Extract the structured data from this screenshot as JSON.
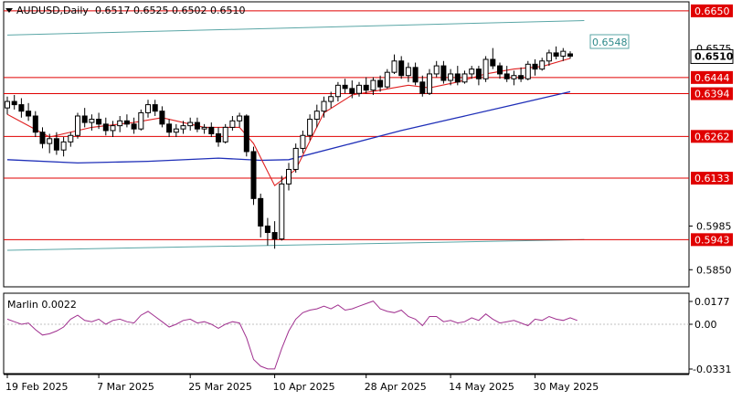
{
  "header": {
    "symbol_timeframe": "AUDUSD,Daily",
    "ohlc": "0.6517 0.6525 0.6502 0.6510"
  },
  "indicator": {
    "label": "Marlin 0.0022",
    "levels": [
      "0.0177",
      "0.00",
      "-0.0331"
    ]
  },
  "price_labels": {
    "current": "0.6510",
    "channel": "0.6548",
    "partial": "0.6575",
    "plain": [
      "0.5985",
      "0.5850"
    ]
  },
  "levels": [
    {
      "price": 0.665,
      "label": "0.6650"
    },
    {
      "price": 0.6444,
      "label": "0.6444"
    },
    {
      "price": 0.6394,
      "label": "0.6394"
    },
    {
      "price": 0.6262,
      "label": "0.6262"
    },
    {
      "price": 0.6133,
      "label": "0.6133"
    },
    {
      "price": 0.5943,
      "label": "0.5943"
    }
  ],
  "x_ticks": [
    {
      "i": 0,
      "label": "19 Feb 2025"
    },
    {
      "i": 13,
      "label": "7 Mar 2025"
    },
    {
      "i": 26,
      "label": "25 Mar 2025"
    },
    {
      "i": 38,
      "label": "10 Apr 2025"
    },
    {
      "i": 51,
      "label": "28 Apr 2025"
    },
    {
      "i": 63,
      "label": "14 May 2025"
    },
    {
      "i": 75,
      "label": "30 May 2025"
    }
  ],
  "colors": {
    "level_lines": "#e00000",
    "level_label_bg": "#e00000",
    "ma_fast": "#e02020",
    "ma_slow": "#1f2fb8",
    "channel": "#5aa6a6",
    "oscillator": "#a0308f",
    "candle_bull": "#ffffff",
    "candle_bear": "#000000"
  },
  "chart_data": {
    "type": "candlestick",
    "ylim": [
      0.58,
      0.6675
    ],
    "candles": [
      [
        0.635,
        0.6385,
        0.633,
        0.637
      ],
      [
        0.637,
        0.639,
        0.6345,
        0.636
      ],
      [
        0.636,
        0.638,
        0.632,
        0.634
      ],
      [
        0.634,
        0.6365,
        0.631,
        0.6325
      ],
      [
        0.6325,
        0.634,
        0.626,
        0.6275
      ],
      [
        0.6275,
        0.629,
        0.6225,
        0.624
      ],
      [
        0.624,
        0.627,
        0.621,
        0.6255
      ],
      [
        0.6255,
        0.6275,
        0.6205,
        0.622
      ],
      [
        0.622,
        0.626,
        0.62,
        0.6245
      ],
      [
        0.6245,
        0.6275,
        0.623,
        0.6265
      ],
      [
        0.6265,
        0.6335,
        0.6255,
        0.6325
      ],
      [
        0.6325,
        0.635,
        0.629,
        0.6305
      ],
      [
        0.6305,
        0.633,
        0.628,
        0.6315
      ],
      [
        0.6315,
        0.6335,
        0.6285,
        0.63
      ],
      [
        0.63,
        0.632,
        0.6265,
        0.628
      ],
      [
        0.628,
        0.631,
        0.626,
        0.6295
      ],
      [
        0.6295,
        0.6325,
        0.6275,
        0.631
      ],
      [
        0.631,
        0.633,
        0.629,
        0.63
      ],
      [
        0.63,
        0.632,
        0.627,
        0.6285
      ],
      [
        0.6285,
        0.6345,
        0.628,
        0.6335
      ],
      [
        0.6335,
        0.6375,
        0.632,
        0.636
      ],
      [
        0.636,
        0.6375,
        0.6325,
        0.634
      ],
      [
        0.634,
        0.6355,
        0.629,
        0.63
      ],
      [
        0.63,
        0.6315,
        0.626,
        0.6275
      ],
      [
        0.6275,
        0.63,
        0.626,
        0.6285
      ],
      [
        0.6285,
        0.631,
        0.627,
        0.6295
      ],
      [
        0.6295,
        0.632,
        0.628,
        0.6305
      ],
      [
        0.6305,
        0.632,
        0.6275,
        0.6285
      ],
      [
        0.6285,
        0.63,
        0.627,
        0.629
      ],
      [
        0.629,
        0.6305,
        0.626,
        0.627
      ],
      [
        0.627,
        0.629,
        0.623,
        0.6245
      ],
      [
        0.6245,
        0.63,
        0.624,
        0.629
      ],
      [
        0.629,
        0.6325,
        0.628,
        0.631
      ],
      [
        0.631,
        0.6335,
        0.629,
        0.6325
      ],
      [
        0.6325,
        0.633,
        0.62,
        0.6215
      ],
      [
        0.6215,
        0.623,
        0.605,
        0.607
      ],
      [
        0.607,
        0.6085,
        0.595,
        0.5985
      ],
      [
        0.5985,
        0.601,
        0.5925,
        0.5965
      ],
      [
        0.5965,
        0.6,
        0.5915,
        0.5945
      ],
      [
        0.5945,
        0.614,
        0.594,
        0.6115
      ],
      [
        0.6115,
        0.618,
        0.6095,
        0.616
      ],
      [
        0.616,
        0.624,
        0.615,
        0.6225
      ],
      [
        0.6225,
        0.628,
        0.621,
        0.6265
      ],
      [
        0.6265,
        0.633,
        0.625,
        0.6315
      ],
      [
        0.6315,
        0.636,
        0.629,
        0.634
      ],
      [
        0.634,
        0.6385,
        0.632,
        0.637
      ],
      [
        0.637,
        0.64,
        0.635,
        0.6385
      ],
      [
        0.6385,
        0.643,
        0.637,
        0.642
      ],
      [
        0.642,
        0.644,
        0.6395,
        0.641
      ],
      [
        0.641,
        0.6435,
        0.638,
        0.6395
      ],
      [
        0.6395,
        0.643,
        0.6385,
        0.642
      ],
      [
        0.642,
        0.6445,
        0.6395,
        0.6405
      ],
      [
        0.6405,
        0.6445,
        0.639,
        0.6435
      ],
      [
        0.6435,
        0.645,
        0.64,
        0.6415
      ],
      [
        0.6415,
        0.647,
        0.641,
        0.646
      ],
      [
        0.646,
        0.6515,
        0.6455,
        0.6495
      ],
      [
        0.6495,
        0.651,
        0.644,
        0.645
      ],
      [
        0.645,
        0.649,
        0.643,
        0.6475
      ],
      [
        0.6475,
        0.649,
        0.642,
        0.643
      ],
      [
        0.643,
        0.645,
        0.6385,
        0.6395
      ],
      [
        0.6395,
        0.647,
        0.639,
        0.6455
      ],
      [
        0.6455,
        0.6495,
        0.6445,
        0.648
      ],
      [
        0.648,
        0.6495,
        0.6425,
        0.6435
      ],
      [
        0.6435,
        0.647,
        0.642,
        0.6455
      ],
      [
        0.6455,
        0.648,
        0.642,
        0.643
      ],
      [
        0.643,
        0.6465,
        0.6425,
        0.6455
      ],
      [
        0.6455,
        0.648,
        0.644,
        0.647
      ],
      [
        0.647,
        0.648,
        0.642,
        0.644
      ],
      [
        0.644,
        0.651,
        0.643,
        0.65
      ],
      [
        0.65,
        0.6535,
        0.647,
        0.648
      ],
      [
        0.648,
        0.649,
        0.644,
        0.6455
      ],
      [
        0.6455,
        0.648,
        0.643,
        0.644
      ],
      [
        0.644,
        0.6465,
        0.642,
        0.645
      ],
      [
        0.645,
        0.6475,
        0.643,
        0.644
      ],
      [
        0.644,
        0.6495,
        0.6435,
        0.6485
      ],
      [
        0.6485,
        0.65,
        0.645,
        0.647
      ],
      [
        0.647,
        0.6505,
        0.6465,
        0.6495
      ],
      [
        0.6495,
        0.653,
        0.648,
        0.652
      ],
      [
        0.652,
        0.654,
        0.65,
        0.651
      ],
      [
        0.651,
        0.6535,
        0.6495,
        0.6525
      ],
      [
        0.6517,
        0.6525,
        0.6502,
        0.651
      ]
    ],
    "marlin": [
      0.004,
      0.002,
      0.0,
      0.001,
      -0.004,
      -0.008,
      -0.007,
      -0.005,
      -0.002,
      0.004,
      0.007,
      0.003,
      0.002,
      0.004,
      0.0,
      0.003,
      0.004,
      0.002,
      0.001,
      0.007,
      0.01,
      0.006,
      0.002,
      -0.002,
      0.0,
      0.003,
      0.004,
      0.001,
      0.002,
      0.0,
      -0.003,
      0.0,
      0.002,
      0.001,
      -0.01,
      -0.026,
      -0.031,
      -0.033,
      -0.033,
      -0.018,
      -0.005,
      0.004,
      0.009,
      0.011,
      0.012,
      0.014,
      0.012,
      0.015,
      0.011,
      0.012,
      0.014,
      0.016,
      0.018,
      0.012,
      0.01,
      0.009,
      0.011,
      0.006,
      0.004,
      -0.001,
      0.006,
      0.006,
      0.002,
      0.003,
      0.001,
      0.002,
      0.005,
      0.003,
      0.008,
      0.004,
      0.001,
      0.002,
      0.003,
      0.001,
      -0.001,
      0.004,
      0.003,
      0.006,
      0.004,
      0.003,
      0.005,
      0.003
    ],
    "ma_slow": [
      [
        0,
        0.619
      ],
      [
        10,
        0.618
      ],
      [
        20,
        0.6185
      ],
      [
        30,
        0.6195
      ],
      [
        36,
        0.6188
      ],
      [
        40,
        0.619
      ],
      [
        48,
        0.6235
      ],
      [
        56,
        0.628
      ],
      [
        64,
        0.632
      ],
      [
        72,
        0.636
      ],
      [
        80,
        0.64
      ]
    ],
    "ma_fast": [
      [
        0,
        0.633
      ],
      [
        6,
        0.626
      ],
      [
        12,
        0.629
      ],
      [
        18,
        0.6305
      ],
      [
        22,
        0.632
      ],
      [
        28,
        0.629
      ],
      [
        33,
        0.629
      ],
      [
        35,
        0.624
      ],
      [
        38,
        0.611
      ],
      [
        41,
        0.616
      ],
      [
        45,
        0.6335
      ],
      [
        49,
        0.639
      ],
      [
        53,
        0.6405
      ],
      [
        57,
        0.642
      ],
      [
        60,
        0.6412
      ],
      [
        64,
        0.643
      ],
      [
        68,
        0.6455
      ],
      [
        72,
        0.647
      ],
      [
        76,
        0.6478
      ],
      [
        80,
        0.6503
      ]
    ],
    "channel_upper": [
      [
        0,
        0.6575
      ],
      [
        82,
        0.662
      ]
    ],
    "channel_lower": [
      [
        0,
        0.591
      ],
      [
        82,
        0.5943
      ]
    ]
  }
}
